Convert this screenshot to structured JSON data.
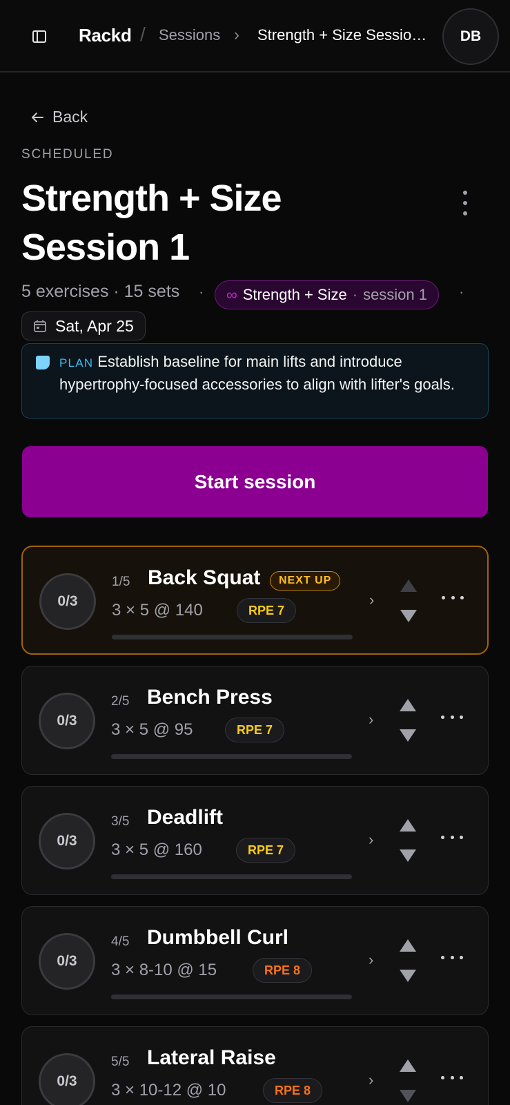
{
  "header": {
    "brand": "Rackd",
    "separator": "/",
    "crumb_sessions": "Sessions",
    "crumb_chevron": "›",
    "crumb_current": "Strength + Size Session 1",
    "avatar_initials": "DB",
    "sidebar_icon": "sidebar-toggle-icon"
  },
  "session": {
    "back_label": "Back",
    "status": "SCHEDULED",
    "title": "Strength + Size Session 1",
    "summary": "5 exercises · 15 sets",
    "meta_dot": "·",
    "program_symbol": "∞",
    "program_name": "Strength + Size",
    "program_sep": "·",
    "program_session": "session 1",
    "date": "Sat, Apr 25",
    "plan_tag": "PLAN",
    "plan_text": "Establish baseline for main lifts and introduce hypertrophy-focused accessories to align with lifter's goals.",
    "start_label": "Start session"
  },
  "exercises": [
    {
      "index": "1/5",
      "name": "Back Squat",
      "badge": "NEXT UP",
      "sets": "3 × 5 @ 140",
      "rpe": "RPE 7",
      "rpe_color": "#facc15",
      "counter": "0/3",
      "progress": 0
    },
    {
      "index": "2/5",
      "name": "Bench Press",
      "sets": "3 × 5 @ 95",
      "rpe": "RPE 7",
      "rpe_color": "#facc15",
      "counter": "0/3",
      "progress": 0
    },
    {
      "index": "3/5",
      "name": "Deadlift",
      "sets": "3 × 5 @ 160",
      "rpe": "RPE 7",
      "rpe_color": "#facc15",
      "counter": "0/3",
      "progress": 0
    },
    {
      "index": "4/5",
      "name": "Dumbbell Curl",
      "sets": "3 × 8-10 @ 15",
      "rpe": "RPE 8",
      "rpe_color": "#f97316",
      "counter": "0/3",
      "progress": 0
    },
    {
      "index": "5/5",
      "name": "Lateral Raise",
      "sets": "3 × 10-12 @ 10",
      "rpe": "RPE 8",
      "rpe_color": "#f97316",
      "counter": "0/3",
      "progress": 0
    }
  ],
  "colors": {
    "accent": "#8b0090",
    "next_up": "#ca8a04",
    "plan_border": "#16445a"
  }
}
